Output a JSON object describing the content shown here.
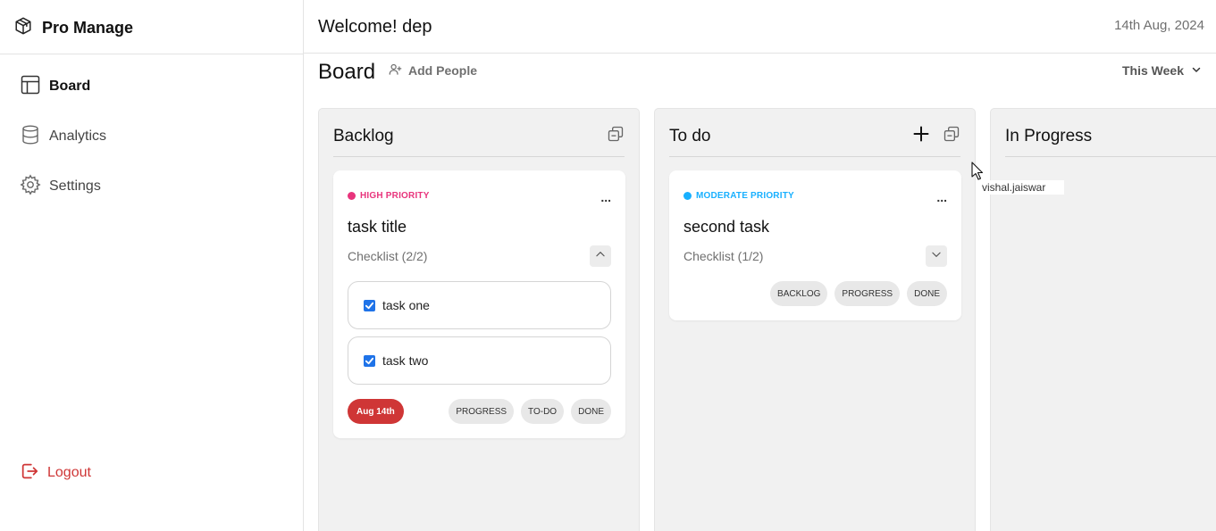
{
  "app": {
    "name": "Pro Manage"
  },
  "sidebar": {
    "items": [
      {
        "label": "Board",
        "icon": "layout-icon"
      },
      {
        "label": "Analytics",
        "icon": "database-icon"
      },
      {
        "label": "Settings",
        "icon": "gear-icon"
      }
    ],
    "logout_label": "Logout"
  },
  "header": {
    "welcome": "Welcome! dep",
    "date": "14th Aug, 2024",
    "board_title": "Board",
    "add_people_label": "Add People",
    "filter_label": "This Week"
  },
  "columns": [
    {
      "title": "Backlog",
      "cards": [
        {
          "priority": "HIGH PRIORITY",
          "priority_color": "#e8347c",
          "title": "task title",
          "checklist_label": "Checklist (2/2)",
          "expanded": true,
          "items": [
            {
              "text": "task one",
              "checked": true
            },
            {
              "text": "task two",
              "checked": true
            }
          ],
          "due": "Aug 14th",
          "due_color": "#cf3636",
          "actions": [
            "PROGRESS",
            "TO-DO",
            "DONE"
          ]
        }
      ]
    },
    {
      "title": "To do",
      "cards": [
        {
          "priority": "MODERATE PRIORITY",
          "priority_color": "#18b0ff",
          "title": "second task",
          "checklist_label": "Checklist (1/2)",
          "expanded": false,
          "actions": [
            "BACKLOG",
            "PROGRESS",
            "DONE"
          ]
        }
      ]
    },
    {
      "title": "In Progress",
      "cards": []
    }
  ],
  "tooltip": {
    "text": "vishal.jaiswar"
  },
  "colors": {
    "accent": "#1f73e8",
    "danger": "#cf3636",
    "column_bg": "#f1f1f1"
  }
}
